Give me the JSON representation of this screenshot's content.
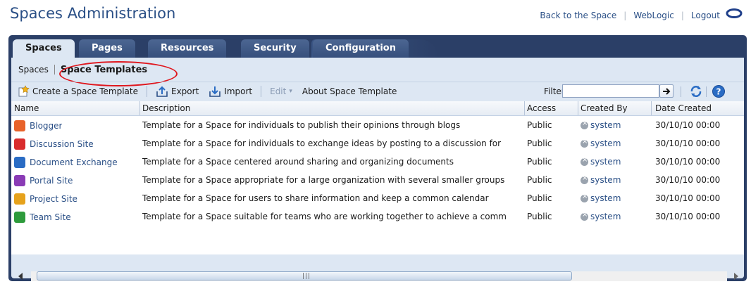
{
  "header": {
    "title": "Spaces Administration",
    "links": [
      "Back to the Space",
      "WebLogic",
      "Logout"
    ],
    "logo_icon": "oracle-o-logo"
  },
  "tabs": [
    {
      "label": "Spaces",
      "active": true
    },
    {
      "label": "Pages",
      "active": false
    },
    {
      "label": "Resources",
      "active": false
    },
    {
      "label": "Security",
      "active": false
    },
    {
      "label": "Configuration",
      "active": false
    }
  ],
  "subnav": {
    "items": [
      "Spaces",
      "Space Templates"
    ],
    "current": "Space Templates"
  },
  "toolbar": {
    "create_label": "Create a Space Template",
    "export_label": "Export",
    "import_label": "Import",
    "edit_label": "Edit",
    "about_label": "About Space Template",
    "filter_label": "Filter",
    "filter_value": ""
  },
  "table": {
    "columns": [
      "Name",
      "Description",
      "Access",
      "Created By",
      "Date Created"
    ],
    "rows": [
      {
        "name": "Blogger",
        "icon": "blogger-icon",
        "icon_color": "#e8622a",
        "description": "Template for a Space for individuals to publish their opinions through blogs",
        "access": "Public",
        "created_by": "system",
        "date": "30/10/10 00:00"
      },
      {
        "name": "Discussion Site",
        "icon": "discussion-icon",
        "icon_color": "#d92c2c",
        "description": "Template for a Space for individuals to exchange ideas by posting to a discussion for",
        "access": "Public",
        "created_by": "system",
        "date": "30/10/10 00:00"
      },
      {
        "name": "Document Exchange",
        "icon": "document-exchange-icon",
        "icon_color": "#2a6cc4",
        "description": "Template for a Space centered around sharing and organizing documents",
        "access": "Public",
        "created_by": "system",
        "date": "30/10/10 00:00"
      },
      {
        "name": "Portal Site",
        "icon": "portal-icon",
        "icon_color": "#8a3bb5",
        "description": "Template for a Space appropriate for a large organization with several smaller groups",
        "access": "Public",
        "created_by": "system",
        "date": "30/10/10 00:00"
      },
      {
        "name": "Project Site",
        "icon": "project-icon",
        "icon_color": "#e6a21c",
        "description": "Template for a Space for users to share information and keep a common calendar",
        "access": "Public",
        "created_by": "system",
        "date": "30/10/10 00:00"
      },
      {
        "name": "Team Site",
        "icon": "team-icon",
        "icon_color": "#2e9b3c",
        "description": "Template for a Space suitable for teams who are working together to achieve a comm",
        "access": "Public",
        "created_by": "system",
        "date": "30/10/10 00:00"
      }
    ]
  },
  "colors": {
    "header_text": "#2a4f86",
    "frame": "#2b3f67",
    "panel": "#dde7f3",
    "highlight_ellipse": "#e0161d"
  }
}
